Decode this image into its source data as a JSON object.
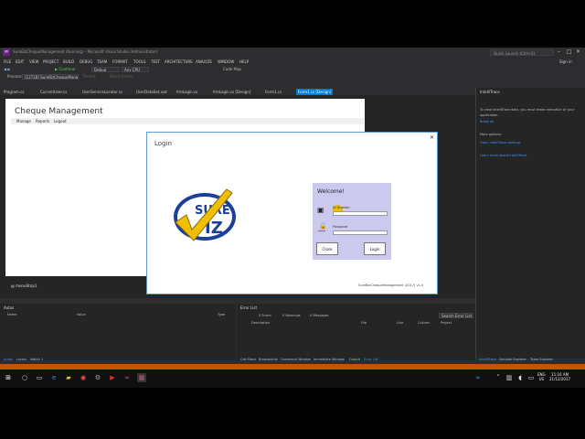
{
  "window": {
    "title": "SureBizChequeManagement (Running) - Microsoft Visual Studio (Administrator)",
    "quick_launch_placeholder": "Quick Launch (Ctrl+Q)",
    "sign_in": "Sign in"
  },
  "menubar": [
    "FILE",
    "EDIT",
    "VIEW",
    "PROJECT",
    "BUILD",
    "DEBUG",
    "TEAM",
    "FORMAT",
    "TOOLS",
    "TEST",
    "ARCHITECTURE",
    "ANALYZE",
    "WINDOW",
    "HELP"
  ],
  "toolbar": {
    "continue": "Continue",
    "config": "Debug",
    "cpu": "Any CPU",
    "codemap": "Code Map",
    "process_label": "Process:",
    "process_value": "[12728] SureBizChequeManageme",
    "thread_label": "Thread:",
    "stack_label": "Stack Frame:"
  },
  "tabs": [
    "Program.cs",
    "CurrentUser.cs",
    "UserServiceLocator.cs",
    "UserDataSet.xsd",
    "frmLogin.cs",
    "frmLogin.cs [Design]",
    "Form1.cs",
    "Form1.cs [Design]"
  ],
  "designer": {
    "title": "Cheque Management",
    "menu": [
      "Manage",
      "Reports",
      "Logout"
    ],
    "tray_item": "menuStrip1"
  },
  "login": {
    "title": "Login",
    "welcome": "Welcome!",
    "id_label": "ID Number",
    "password_label": "Password",
    "close_btn": "Close",
    "login_btn": "Login",
    "footer": "SureBizChequeManagement (2017) v1.0"
  },
  "intellitrace": {
    "title": "IntelliTrace",
    "line1": "To view IntelliTrace data, you must break execution of your",
    "line2": "application.",
    "break_all": "Break all",
    "more_options": "More options:",
    "settings_link": "Open IntelliTrace settings",
    "learn_more": "Learn more about IntelliTrace"
  },
  "autos": {
    "title": "Autos",
    "cols": [
      "Name",
      "Value",
      "Type"
    ],
    "bottom_tabs": [
      "Autos",
      "Locals",
      "Watch 1"
    ]
  },
  "errorlist": {
    "title": "Error List",
    "filters": [
      "0 Errors",
      "0 Warnings",
      "0 Messages"
    ],
    "search": "Search Error List",
    "cols": [
      "Description",
      "File",
      "Line",
      "Column",
      "Project"
    ],
    "bottom_tabs": [
      "Call Stack",
      "Breakpoints",
      "Command Window",
      "Immediate Window",
      "Output",
      "Error List"
    ]
  },
  "right_tabs": [
    "IntelliTrace",
    "Solution Explorer",
    "Team Explorer"
  ],
  "taskbar": {
    "lang": "ENG",
    "region": "US",
    "time": "11:16 AM",
    "date": "21/12/2017"
  }
}
